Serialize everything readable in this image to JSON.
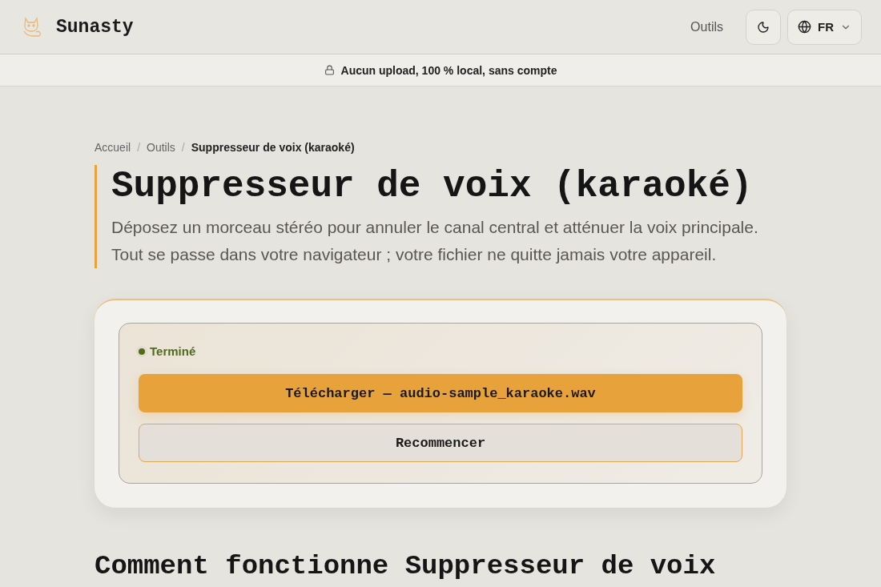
{
  "header": {
    "brand": "Sunasty",
    "nav_link": "Outils",
    "language": "FR"
  },
  "banner": {
    "text": "Aucun upload, 100 % local, sans compte"
  },
  "breadcrumb_separator": "/",
  "breadcrumb": [
    {
      "label": "Accueil",
      "current": false
    },
    {
      "label": "Outils",
      "current": false
    },
    {
      "label": "Suppresseur de voix (karaoké)",
      "current": true
    }
  ],
  "title": "Suppresseur de voix (karaoké)",
  "description": "Déposez un morceau stéréo pour annuler le canal central et atténuer la voix principale. Tout se passe dans votre navigateur ; votre fichier ne quitte jamais votre appareil.",
  "result": {
    "status": {
      "label": "Terminé",
      "color": "#4f6b1c"
    },
    "download_button": "Télécharger — audio-sample_karaoke.wav",
    "restart_button": "Recommencer"
  },
  "section_heading": "Comment fonctionne Suppresseur de voix"
}
